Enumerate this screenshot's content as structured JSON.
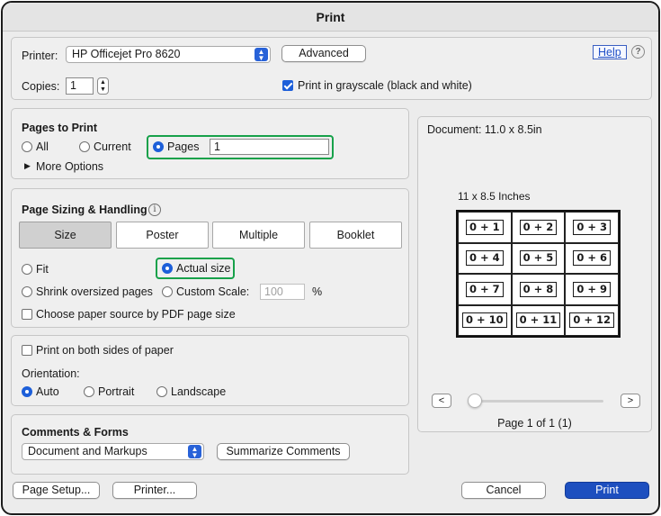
{
  "window": {
    "title": "Print"
  },
  "printer": {
    "label": "Printer:",
    "selected": "HP Officejet Pro 8620",
    "advanced_label": "Advanced",
    "help_label": "Help",
    "help_icon_text": "?",
    "copies_label": "Copies:",
    "copies_value": "1",
    "grayscale_label": "Print in grayscale (black and white)",
    "grayscale_checked": true
  },
  "pages_to_print": {
    "title": "Pages to Print",
    "options": [
      "All",
      "Current",
      "Pages"
    ],
    "selected": "Pages",
    "pages_value": "1",
    "more_options_label": "More Options"
  },
  "sizing": {
    "title": "Page Sizing & Handling",
    "info_icon_text": "i",
    "tabs": [
      "Size",
      "Poster",
      "Multiple",
      "Booklet"
    ],
    "active_tab": "Size",
    "fit_label": "Fit",
    "actual_size_label": "Actual size",
    "shrink_label": "Shrink oversized pages",
    "custom_scale_label": "Custom Scale:",
    "custom_scale_value": "100",
    "percent": "%",
    "paper_source_label": "Choose paper source by PDF page size",
    "selected": "Actual size"
  },
  "duplex": {
    "both_sides_label": "Print on both sides of paper",
    "orientation_label": "Orientation:",
    "orientations": [
      "Auto",
      "Portrait",
      "Landscape"
    ],
    "selected": "Auto"
  },
  "comments": {
    "title": "Comments & Forms",
    "selected": "Document and Markups",
    "summarize_label": "Summarize Comments"
  },
  "preview": {
    "document_size": "Document: 11.0 x 8.5in",
    "paper_label": "11 x 8.5 Inches",
    "cells": [
      "0 + 1",
      "0 + 2",
      "0 + 3",
      "0 + 4",
      "0 + 5",
      "0 + 6",
      "0 + 7",
      "0 + 8",
      "0 + 9",
      "0 + 10",
      "0 + 11",
      "0 + 12"
    ],
    "prev_label": "<",
    "next_label": ">",
    "page_indicator": "Page 1 of 1 (1)"
  },
  "footer": {
    "page_setup_label": "Page Setup...",
    "printer_label": "Printer...",
    "cancel_label": "Cancel",
    "print_label": "Print"
  },
  "colors": {
    "accent": "#1d5fd9",
    "primary_button": "#1d4fbf",
    "highlight": "#17a14a"
  }
}
